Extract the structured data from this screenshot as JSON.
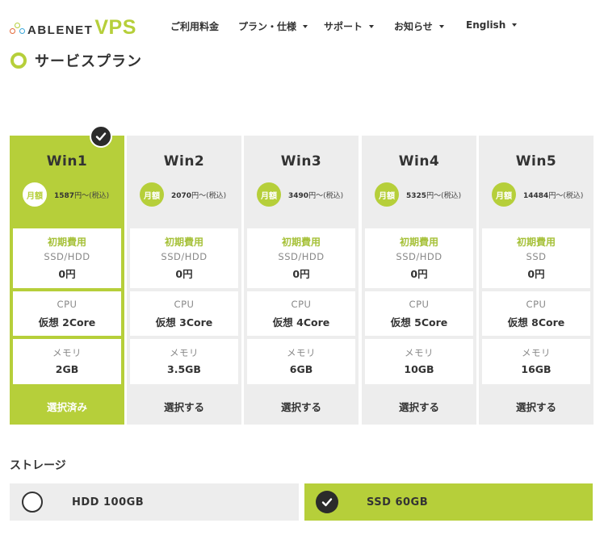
{
  "header": {
    "logo_text": "ABLENET",
    "logo_vps": "VPS",
    "nav": [
      {
        "label": "ご利用料金",
        "has_caret": false
      },
      {
        "label": "プラン・仕様",
        "has_caret": true
      },
      {
        "label": "サポート",
        "has_caret": true
      },
      {
        "label": "お知らせ",
        "has_caret": true
      },
      {
        "label": "English",
        "has_caret": true
      }
    ]
  },
  "section": {
    "title": "サービスプラン"
  },
  "plans": [
    {
      "name": "Win1",
      "badge": "月額",
      "price": "1587",
      "unit": "円〜",
      "tax": "(税込)",
      "initial_label": "初期費用",
      "disk": "SSD/HDD",
      "initial_fee": "0円",
      "cpu_label": "CPU",
      "cpu": "仮想 2Core",
      "mem_label": "メモリ",
      "memory": "2GB",
      "button": "選択済み",
      "selected": true
    },
    {
      "name": "Win2",
      "badge": "月額",
      "price": "2070",
      "unit": "円〜",
      "tax": "(税込)",
      "initial_label": "初期費用",
      "disk": "SSD/HDD",
      "initial_fee": "0円",
      "cpu_label": "CPU",
      "cpu": "仮想 3Core",
      "mem_label": "メモリ",
      "memory": "3.5GB",
      "button": "選択する",
      "selected": false
    },
    {
      "name": "Win3",
      "badge": "月額",
      "price": "3490",
      "unit": "円〜",
      "tax": "(税込)",
      "initial_label": "初期費用",
      "disk": "SSD/HDD",
      "initial_fee": "0円",
      "cpu_label": "CPU",
      "cpu": "仮想 4Core",
      "mem_label": "メモリ",
      "memory": "6GB",
      "button": "選択する",
      "selected": false
    },
    {
      "name": "Win4",
      "badge": "月額",
      "price": "5325",
      "unit": "円〜",
      "tax": "(税込)",
      "initial_label": "初期費用",
      "disk": "SSD/HDD",
      "initial_fee": "0円",
      "cpu_label": "CPU",
      "cpu": "仮想 5Core",
      "mem_label": "メモリ",
      "memory": "10GB",
      "button": "選択する",
      "selected": false
    },
    {
      "name": "Win5",
      "badge": "月額",
      "price": "14484",
      "unit": "円〜",
      "tax": "(税込)",
      "initial_label": "初期費用",
      "disk": "SSD",
      "initial_fee": "0円",
      "cpu_label": "CPU",
      "cpu": "仮想 8Core",
      "mem_label": "メモリ",
      "memory": "16GB",
      "button": "選択する",
      "selected": false
    }
  ],
  "storage": {
    "title": "ストレージ",
    "options": [
      {
        "label": "HDD 100GB",
        "selected": false
      },
      {
        "label": "SSD 60GB",
        "selected": true
      }
    ]
  },
  "colors": {
    "accent": "#b6cf3a",
    "panel": "#ededed",
    "text": "#333333",
    "check": "#2b2b2b"
  },
  "icons": {
    "plan_check": "check-circle-icon",
    "storage_check": "check-circle-icon",
    "storage_unchecked": "radio-empty-icon",
    "nav_caret": "caret-down-icon",
    "section_marker": "ring-icon"
  }
}
